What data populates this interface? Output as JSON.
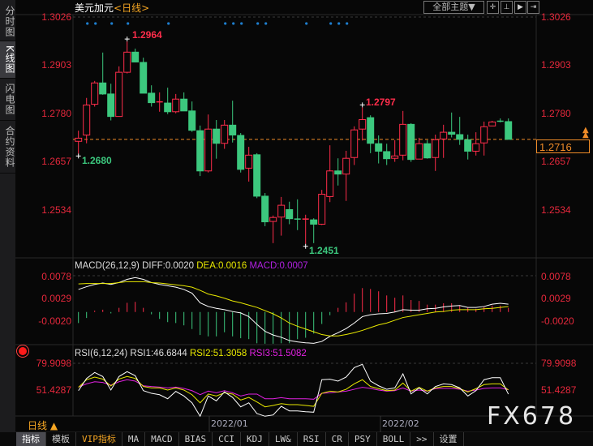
{
  "sidebar": {
    "tabs": [
      {
        "label": "分时图",
        "active": false
      },
      {
        "label": "K线图",
        "active": true
      },
      {
        "label": "闪电图",
        "active": false
      },
      {
        "label": "合约资料",
        "active": false
      }
    ]
  },
  "header": {
    "symbol": "美元加元",
    "period": "<日线>",
    "theme_button": "全部主题▼",
    "icon_buttons": [
      "crosshair-icon",
      "zoom-range-icon",
      "play-icon",
      "step-forward-icon"
    ]
  },
  "price_axis": {
    "labels": [
      "1.3026",
      "1.2903",
      "1.2780",
      "1.2657",
      "1.2534"
    ],
    "last_price": "1.2716"
  },
  "annotations": {
    "high1": "1.2964",
    "low1": "1.2680",
    "high2": "1.2797",
    "low2": "1.2451"
  },
  "macd_pane": {
    "title": "MACD(26,12,9)",
    "diff": "DIFF:0.0020",
    "dea": "DEA:0.0016",
    "macd": "MACD:0.0007",
    "labels": [
      "0.0078",
      "0.0029",
      "-0.0020"
    ]
  },
  "rsi_pane": {
    "title": "RSI(6,12,24)",
    "rsi1": "RSI1:46.6844",
    "rsi2": "RSI2:51.3058",
    "rsi3": "RSI3:51.5082",
    "labels": [
      "79.9098",
      "51.4287"
    ]
  },
  "date_axis": {
    "labels": [
      "2022/01",
      "2022/02"
    ]
  },
  "period_selector": "日线 ▲",
  "watermark": "FX678",
  "toolbar": {
    "items": [
      {
        "label": "指标",
        "active": true
      },
      {
        "label": "模板"
      },
      {
        "label": "VIP指标",
        "vip": true
      },
      {
        "label": "MA"
      },
      {
        "label": "MACD"
      },
      {
        "label": "BIAS"
      },
      {
        "label": "CCI"
      },
      {
        "label": "KDJ"
      },
      {
        "label": "LW&"
      },
      {
        "label": "RSI"
      },
      {
        "label": "CR"
      },
      {
        "label": "PSY"
      },
      {
        "label": "BOLL"
      },
      {
        "label": ">>"
      },
      {
        "label": "设置"
      }
    ]
  },
  "colors": {
    "up": "#ff2d4b",
    "down": "#3cc87e",
    "axis_text": "#e6283c",
    "last_price": "#f08c28",
    "diff": "#ffffff",
    "dea": "#e8e800",
    "rsi3": "#e020e0",
    "event_dot": "#1e7fd0"
  },
  "chart_data": [
    {
      "type": "candlestick",
      "ylim": [
        1.2451,
        1.3026
      ],
      "y_ticks": [
        1.3026,
        1.2903,
        1.278,
        1.2657,
        1.2534
      ],
      "last_price": 1.2716,
      "event_marker_candles": [
        2,
        3,
        5,
        7,
        12,
        19,
        20,
        21,
        23,
        24,
        29,
        32,
        33,
        34
      ],
      "ohlc": [
        [
          1.2711,
          1.2738,
          1.268,
          1.2719
        ],
        [
          1.2727,
          1.2821,
          1.2706,
          1.2803
        ],
        [
          1.2805,
          1.2864,
          1.2799,
          1.2859
        ],
        [
          1.2859,
          1.2936,
          1.2829,
          1.2831
        ],
        [
          1.2831,
          1.2857,
          1.2764,
          1.2774
        ],
        [
          1.2774,
          1.2901,
          1.2774,
          1.2886
        ],
        [
          1.2886,
          1.2964,
          1.2883,
          1.2937
        ],
        [
          1.2937,
          1.2946,
          1.2912,
          1.2912
        ],
        [
          1.2911,
          1.2923,
          1.2833,
          1.2833
        ],
        [
          1.2833,
          1.2853,
          1.2799,
          1.2809
        ],
        [
          1.281,
          1.2835,
          1.2786,
          1.2811
        ],
        [
          1.2808,
          1.2847,
          1.278,
          1.2786
        ],
        [
          1.2786,
          1.2831,
          1.2782,
          1.2818
        ],
        [
          1.2818,
          1.2835,
          1.2788,
          1.2788
        ],
        [
          1.2788,
          1.2812,
          1.2735,
          1.2739
        ],
        [
          1.2738,
          1.2751,
          1.2623,
          1.2636
        ],
        [
          1.2636,
          1.2779,
          1.2632,
          1.2742
        ],
        [
          1.2742,
          1.2765,
          1.2667,
          1.2706
        ],
        [
          1.2706,
          1.2765,
          1.2692,
          1.2752
        ],
        [
          1.2752,
          1.2814,
          1.2708,
          1.2727
        ],
        [
          1.2726,
          1.2732,
          1.2632,
          1.264
        ],
        [
          1.2643,
          1.2697,
          1.2609,
          1.2676
        ],
        [
          1.2677,
          1.2681,
          1.2567,
          1.2572
        ],
        [
          1.2572,
          1.258,
          1.2496,
          1.2507
        ],
        [
          1.2508,
          1.2523,
          1.2453,
          1.2518
        ],
        [
          1.2519,
          1.257,
          1.2472,
          1.2549
        ],
        [
          1.2538,
          1.2558,
          1.2501,
          1.2515
        ],
        [
          1.2514,
          1.2564,
          1.2486,
          1.2513
        ],
        [
          1.2512,
          1.2525,
          1.2451,
          1.2514
        ],
        [
          1.2512,
          1.2516,
          1.2453,
          1.2501
        ],
        [
          1.2501,
          1.2588,
          1.2499,
          1.2577
        ],
        [
          1.2571,
          1.2701,
          1.2557,
          1.2636
        ],
        [
          1.2636,
          1.2668,
          1.2599,
          1.2628
        ],
        [
          1.2628,
          1.2687,
          1.256,
          1.2668
        ],
        [
          1.267,
          1.2749,
          1.2651,
          1.274
        ],
        [
          1.2742,
          1.2797,
          1.2713,
          1.2766
        ],
        [
          1.2771,
          1.2777,
          1.2681,
          1.2706
        ],
        [
          1.2705,
          1.2726,
          1.2655,
          1.2686
        ],
        [
          1.2685,
          1.2705,
          1.2651,
          1.2667
        ],
        [
          1.2668,
          1.2714,
          1.2659,
          1.2674
        ],
        [
          1.2676,
          1.2788,
          1.2663,
          1.2754
        ],
        [
          1.2754,
          1.2757,
          1.2659,
          1.2665
        ],
        [
          1.2666,
          1.272,
          1.2666,
          1.2705
        ],
        [
          1.2705,
          1.2714,
          1.2667,
          1.2669
        ],
        [
          1.267,
          1.2728,
          1.2636,
          1.2715
        ],
        [
          1.2717,
          1.2753,
          1.2669,
          1.2734
        ],
        [
          1.2734,
          1.2784,
          1.2721,
          1.2729
        ],
        [
          1.2728,
          1.2773,
          1.2702,
          1.2716
        ],
        [
          1.2715,
          1.2728,
          1.2665,
          1.2686
        ],
        [
          1.2686,
          1.2734,
          1.2675,
          1.2705
        ],
        [
          1.2707,
          1.2761,
          1.2675,
          1.2748
        ],
        [
          1.275,
          1.2763,
          1.275,
          1.276
        ],
        [
          1.2762,
          1.2769,
          1.2759,
          1.2761
        ],
        [
          1.2761,
          1.2769,
          1.2716,
          1.2716
        ]
      ]
    },
    {
      "type": "bar",
      "y_ticks": [
        0.0078,
        0.0029,
        -0.002
      ],
      "series": [
        {
          "name": "MACD",
          "values": [
            -0.0024,
            -0.0013,
            0.0003,
            0.0005,
            -0.0003,
            0.0009,
            0.002,
            0.0022,
            0.0009,
            -0.0005,
            -0.0015,
            -0.0022,
            -0.0024,
            -0.0029,
            -0.0037,
            -0.005,
            -0.0053,
            -0.0053,
            -0.0044,
            -0.0053,
            -0.0057,
            -0.0059,
            -0.0068,
            -0.0069,
            -0.0069,
            -0.0068,
            -0.0068,
            -0.0059,
            -0.0056,
            -0.0047,
            -0.0026,
            -0.0007,
            0.0009,
            0.0021,
            0.004,
            0.0052,
            0.005,
            0.0045,
            0.0036,
            0.0031,
            0.0036,
            0.0026,
            0.0024,
            0.0016,
            0.0016,
            0.0019,
            0.0019,
            0.0013,
            0.0009,
            0.0007,
            0.0011,
            0.0014,
            0.0014,
            0.0009
          ]
        },
        {
          "name": "DIFF",
          "values": [
            0.0049,
            0.0055,
            0.006,
            0.0063,
            0.006,
            0.0064,
            0.0071,
            0.0075,
            0.0071,
            0.0064,
            0.006,
            0.0057,
            0.0054,
            0.0049,
            0.0041,
            0.002,
            0.0012,
            0.0008,
            0.0005,
            0.0001,
            -0.0002,
            -0.001,
            -0.0027,
            -0.0042,
            -0.005,
            -0.0055,
            -0.0062,
            -0.0065,
            -0.0067,
            -0.0068,
            -0.0064,
            -0.0053,
            -0.0045,
            -0.0036,
            -0.0024,
            -0.001,
            -0.0006,
            -0.0004,
            -0.0003,
            0.0,
            0.0005,
            0.0004,
            0.0004,
            0.0007,
            0.0008,
            0.0011,
            0.0013,
            0.0014,
            0.001,
            0.001,
            0.0012,
            0.0017,
            0.0019,
            0.0017
          ]
        },
        {
          "name": "DEA",
          "values": [
            0.0061,
            0.0062,
            0.0062,
            0.0062,
            0.0062,
            0.0064,
            0.0066,
            0.0066,
            0.0066,
            0.0064,
            0.0063,
            0.0061,
            0.0059,
            0.0057,
            0.0054,
            0.0047,
            0.0039,
            0.0035,
            0.003,
            0.0024,
            0.002,
            0.0015,
            0.001,
            0.0003,
            -0.0004,
            -0.0013,
            -0.0024,
            -0.0031,
            -0.0037,
            -0.0043,
            -0.0049,
            -0.0052,
            -0.0052,
            -0.0049,
            -0.0045,
            -0.004,
            -0.0034,
            -0.0028,
            -0.0024,
            -0.0018,
            -0.0012,
            -0.0009,
            -0.0006,
            -0.0003,
            0.0,
            0.0001,
            0.0004,
            0.0005,
            0.0005,
            0.0005,
            0.0007,
            0.0008,
            0.001,
            0.0012
          ]
        }
      ]
    },
    {
      "type": "line",
      "y_ticks": [
        79.9098,
        51.4287
      ],
      "series": [
        {
          "name": "RSI1",
          "values": [
            50.5,
            63.8,
            70.3,
            65.9,
            51.2,
            65.9,
            71.2,
            66.8,
            50.5,
            47.6,
            46.1,
            41.7,
            49.7,
            44.7,
            37.3,
            22.7,
            44.7,
            39.4,
            49.1,
            43.2,
            32.9,
            37.3,
            25.6,
            22.7,
            24.1,
            33.5,
            28.5,
            28.5,
            27.6,
            27.1,
            62.4,
            62.9,
            60.9,
            65.3,
            75.6,
            79.1,
            60.9,
            55.8,
            52.0,
            53.5,
            68.8,
            47.0,
            53.5,
            47.0,
            55.0,
            57.9,
            57.1,
            53.5,
            44.7,
            50.5,
            62.4,
            64.6,
            64.6,
            46.7
          ]
        },
        {
          "name": "RSI2",
          "values": [
            54.1,
            62.4,
            65.3,
            63.1,
            55.6,
            63.1,
            65.9,
            63.8,
            55.0,
            53.5,
            53.5,
            51.2,
            53.5,
            51.2,
            46.1,
            37.3,
            46.8,
            44.7,
            48.2,
            46.8,
            40.3,
            43.2,
            38.2,
            32.9,
            34.4,
            36.4,
            35.3,
            35.3,
            34.4,
            33.5,
            47.6,
            50.0,
            49.1,
            52.0,
            57.9,
            62.4,
            55.0,
            52.7,
            50.5,
            51.2,
            58.8,
            50.0,
            54.1,
            50.0,
            53.5,
            55.0,
            55.0,
            52.7,
            49.1,
            52.7,
            57.1,
            57.9,
            57.9,
            51.3
          ]
        },
        {
          "name": "RSI3",
          "values": [
            54.4,
            57.9,
            60.2,
            59.4,
            56.5,
            60.2,
            62.4,
            60.9,
            55.8,
            55.0,
            54.4,
            53.5,
            54.4,
            52.9,
            50.5,
            46.1,
            50.0,
            48.2,
            50.5,
            48.2,
            44.7,
            46.8,
            46.8,
            41.7,
            41.7,
            42.9,
            41.7,
            41.7,
            41.7,
            41.2,
            47.6,
            48.2,
            49.1,
            50.0,
            52.0,
            54.1,
            52.9,
            51.2,
            50.0,
            50.5,
            53.5,
            50.0,
            51.2,
            50.0,
            52.7,
            52.9,
            52.9,
            52.0,
            50.0,
            51.2,
            52.9,
            53.5,
            53.5,
            51.5
          ]
        }
      ]
    }
  ]
}
